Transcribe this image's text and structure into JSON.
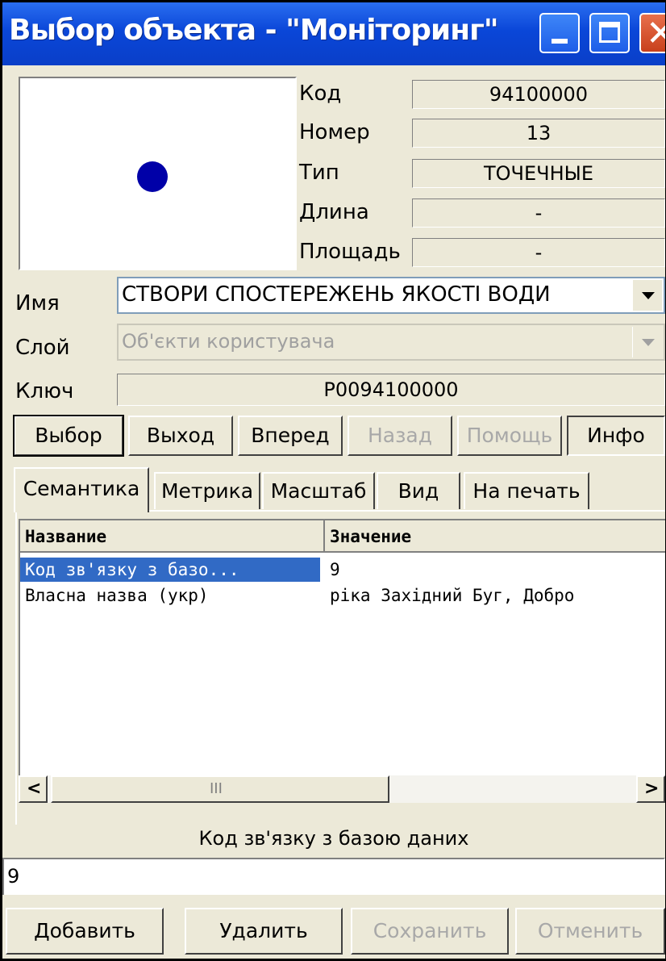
{
  "window": {
    "title": "Выбор объекта - \"Моніторинг\""
  },
  "preview": {
    "symbol_color": "#0000a8"
  },
  "properties": [
    {
      "label": "Код",
      "value": "94100000"
    },
    {
      "label": "Номер",
      "value": "13"
    },
    {
      "label": "Тип",
      "value": "ТОЧЕЧНЫЕ"
    },
    {
      "label": "Длина",
      "value": "-"
    },
    {
      "label": "Площадь",
      "value": "-"
    }
  ],
  "name": {
    "label": "Имя",
    "value": "СТВОРИ СПОСТЕРЕЖЕНЬ ЯКОСТІ ВОДИ"
  },
  "layer": {
    "label": "Слой",
    "value": "Об'єкти користувача"
  },
  "key": {
    "label": "Ключ",
    "value": "P0094100000"
  },
  "nav_buttons": [
    "Выбор",
    "Выход",
    "Вперед",
    "Назад",
    "Помощь",
    "Инфо"
  ],
  "tabs": [
    "Семантика",
    "Метрика",
    "Масштаб",
    "Вид",
    "На печать"
  ],
  "table": {
    "columns": [
      "Название",
      "Значение"
    ],
    "rows": [
      {
        "name": "Код зв'язку з базо...",
        "value": "9"
      },
      {
        "name": "Власна назва (укр)",
        "value": "ріка Західний Буг, Добро"
      }
    ]
  },
  "edit": {
    "label": "Код зв'язку з базою даних",
    "value": "9"
  },
  "action_buttons": [
    "Добавить",
    "Удалить",
    "Сохранить",
    "Отменить"
  ]
}
